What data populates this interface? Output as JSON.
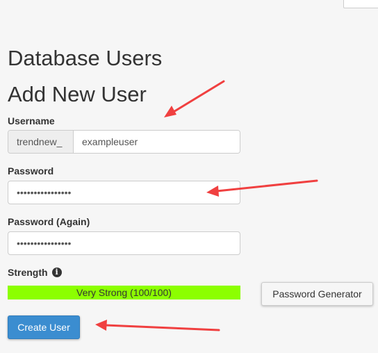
{
  "page": {
    "section_title": "Database Users",
    "subsection_title": "Add New User"
  },
  "form": {
    "username_label": "Username",
    "username_prefix": "trendnew_",
    "username_value": "exampleuser",
    "password_label": "Password",
    "password_value": "••••••••••••••••",
    "password_again_label": "Password (Again)",
    "password_again_value": "••••••••••••••••",
    "strength_label": "Strength",
    "strength_text": "Very Strong (100/100)",
    "strength_fraction": 1.0,
    "password_generator_label": "Password Generator",
    "create_user_label": "Create User"
  },
  "icons": {
    "strength_info": "info-circle-icon",
    "annotation": "red-arrow"
  },
  "colors": {
    "strength_fill": "#8cff00",
    "primary_button": "#3b8dd0",
    "annotation_arrow": "#f04040"
  }
}
